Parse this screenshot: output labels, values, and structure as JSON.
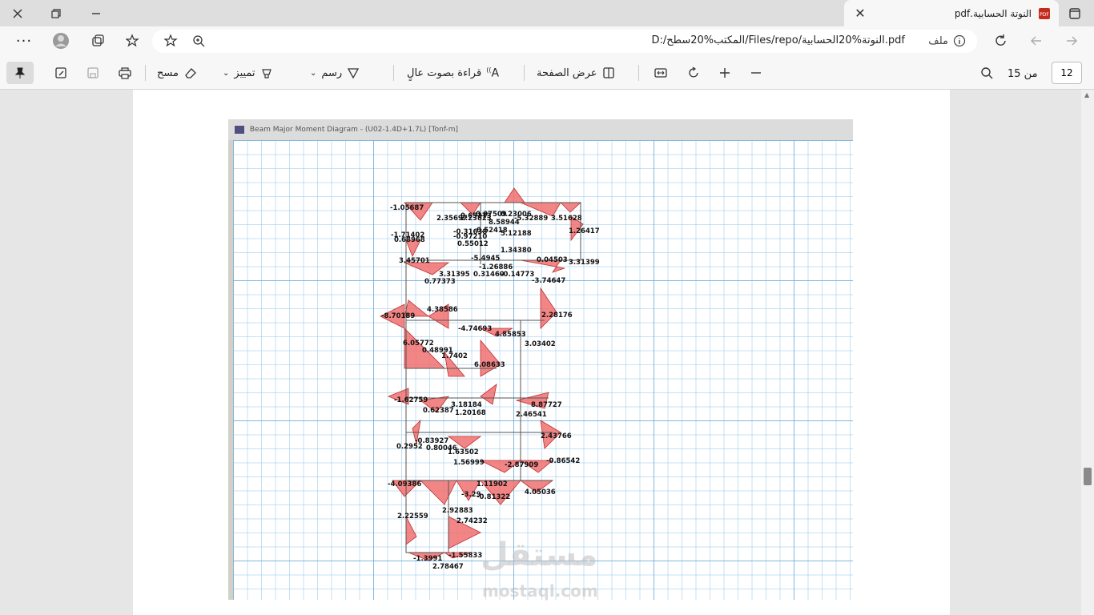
{
  "tab": {
    "title": "النوتة الحسابية.pdf"
  },
  "address": {
    "file_label": "ملف",
    "url": "D:/المكتب%20سطح/Files/repo/النوتة%20الحسابية.pdf"
  },
  "pdf_toolbar": {
    "page_current": "12",
    "page_of": "من 15",
    "page_view": "عرض الصفحة",
    "read_aloud": "قراءة بصوت عالٍ",
    "draw": "رسم",
    "highlight": "تمييز",
    "erase": "مسح"
  },
  "screenshot": {
    "window_title": "Beam Major Moment Diagram - (U02-1.4D+1.7L)  [Tonf-m]"
  },
  "moment_labels": [
    "-1.05687",
    "2.35697",
    "2.23823",
    "0.07509",
    "0.65273",
    "0.23006",
    "-5.32889",
    "3.51628",
    "8.58944",
    "-1.71402",
    "0.68968",
    "-0.31638",
    "-0.97210",
    "0.52418",
    "5.12188",
    "1.26417",
    "3.45701",
    "3.31395",
    "0.55012",
    "-1.26886",
    "-5.4945",
    "1.34380",
    "0.04503",
    "3.31399",
    "0.77373",
    "0.31460",
    "-0.14773",
    "-3.74647",
    "-8.70189",
    "4.38586",
    "2.28176",
    "-4.74693",
    "4.85853",
    "3.03402",
    "6.05772",
    "0.48991",
    "1.7402",
    "6.08633",
    "-1.62759",
    "0.62387",
    "3.18184",
    "2.46541",
    "8.87727",
    "1.20168",
    "-0.83927",
    "0.80046",
    "2.43766",
    "0.2952",
    "1.63502",
    "1.56999",
    "-2.87909",
    "-0.86542",
    "-4.09386",
    "2.92883",
    "-3.29",
    "1.11902",
    "4.05036",
    "-0.81322",
    "2.22559",
    "2.74232",
    "-1.3991",
    "2.78467",
    "-1.55833"
  ],
  "watermark": {
    "brand": "مستقل",
    "domain": "mostaql.com"
  },
  "colors": {
    "diagram_fill": "#f07070",
    "diagram_stroke": "#c03030",
    "grid": "#8cc0e6"
  }
}
